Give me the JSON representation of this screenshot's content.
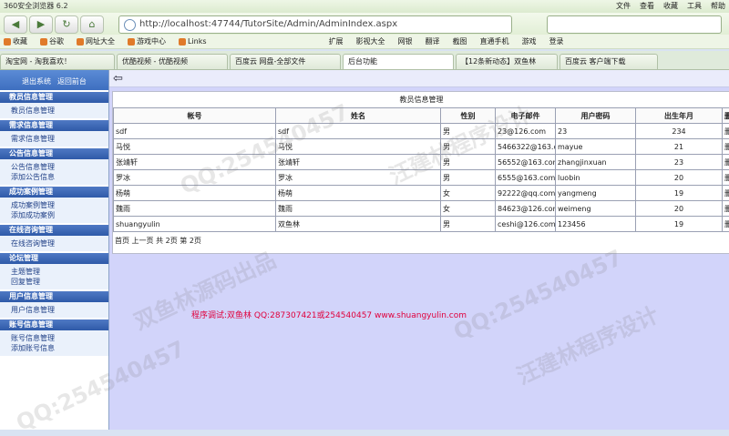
{
  "browser": {
    "title": "360安全浏览器 6.2",
    "menu": [
      "文件",
      "查看",
      "收藏",
      "工具",
      "帮助"
    ],
    "address": "http://localhost:47744/TutorSite/Admin/AdminIndex.aspx",
    "bookmarks": [
      "收藏",
      "谷歌",
      "网址大全",
      "游戏中心",
      "Links",
      "扩展",
      "影视大全",
      "网银",
      "翻译",
      "截图",
      "直通手机",
      "游戏",
      "登录"
    ],
    "tabs": [
      {
        "label": "淘宝网 - 淘我喜欢！"
      },
      {
        "label": "优酷视频 - 优酷视频"
      },
      {
        "label": "百度云 网盘-全部文件"
      },
      {
        "label": "后台功能"
      },
      {
        "label": "【12条新动态】双鱼林"
      },
      {
        "label": "百度云 客户端下载"
      }
    ]
  },
  "sidebar": {
    "top_links": [
      "退出系统",
      "返回前台"
    ],
    "sections": [
      {
        "title": "教员信息管理",
        "items": [
          "教员信息管理"
        ]
      },
      {
        "title": "需求信息管理",
        "items": [
          "需求信息管理"
        ]
      },
      {
        "title": "公告信息管理",
        "items": [
          "公告信息管理",
          "添加公告信息"
        ]
      },
      {
        "title": "成功案例管理",
        "items": [
          "成功案例管理",
          "添加成功案例"
        ]
      },
      {
        "title": "在线咨询管理",
        "items": [
          "在线咨询管理"
        ]
      },
      {
        "title": "论坛管理",
        "items": [
          "主题管理",
          "回复管理"
        ]
      },
      {
        "title": "用户信息管理",
        "items": [
          "用户信息管理"
        ]
      },
      {
        "title": "账号信息管理",
        "items": [
          "账号信息管理",
          "添加账号信息"
        ]
      }
    ]
  },
  "main": {
    "panel_title": "教员信息管理",
    "columns": [
      "帐号",
      "姓名",
      "性别",
      "电子邮件",
      "用户密码",
      "出生年月",
      "删除"
    ],
    "rows": [
      [
        "sdf",
        "sdf",
        "男",
        "23@126.com",
        "23",
        "234",
        "删除"
      ],
      [
        "马悦",
        "马悦",
        "男",
        "5466322@163.com",
        "mayue",
        "21",
        "删除"
      ],
      [
        "张靖轩",
        "张靖轩",
        "男",
        "56552@163.com",
        "zhangjinxuan",
        "23",
        "删除"
      ],
      [
        "罗冰",
        "罗冰",
        "男",
        "6555@163.com",
        "luobin",
        "20",
        "删除"
      ],
      [
        "杨萌",
        "杨萌",
        "女",
        "92222@qq.com",
        "yangmeng",
        "19",
        "删除"
      ],
      [
        "魏雨",
        "魏雨",
        "女",
        "84623@126.com",
        "weimeng",
        "20",
        "删除"
      ],
      [
        "shuangyulin",
        "双鱼林",
        "男",
        "ceshi@126.com",
        "123456",
        "19",
        "删除"
      ]
    ],
    "pager": {
      "first": "首页",
      "prev": "上一页",
      "total": "共 2页",
      "current": "第 2页"
    },
    "credit": "程序调试:双鱼林 QQ:287307421或254540457 www.shuangyulin.com"
  },
  "watermarks": [
    "QQ:254540457",
    "双鱼林源码出品",
    "汪建林程序设计"
  ]
}
